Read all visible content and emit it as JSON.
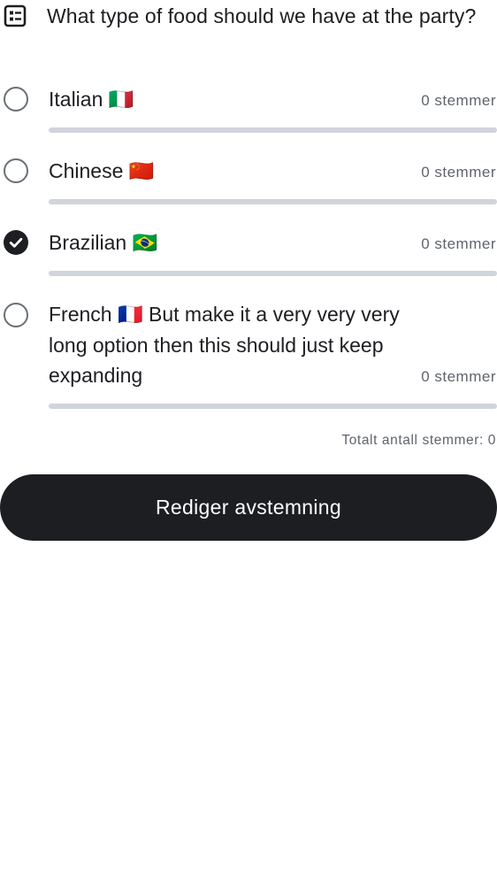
{
  "poll": {
    "icon": "poll-list-icon",
    "question": "What type of food should we have at the party?",
    "options": [
      {
        "label": "Italian 🇮🇹",
        "votes_text": "0 stemmer",
        "selected": false,
        "share": 0
      },
      {
        "label": "Chinese 🇨🇳",
        "votes_text": "0 stemmer",
        "selected": false,
        "share": 0
      },
      {
        "label": "Brazilian 🇧🇷",
        "votes_text": "0 stemmer",
        "selected": true,
        "share": 0
      },
      {
        "label": "French 🇫🇷 But make it a very very very long option then this should just keep expanding",
        "votes_text": "0 stemmer",
        "selected": false,
        "share": 0
      }
    ],
    "total_votes_text": "Totalt antall stemmer: 0",
    "edit_button_label": "Rediger avstemning"
  },
  "colors": {
    "primary": "#1d1e22",
    "muted_text": "#5f646b",
    "bar_track": "#d0d4db",
    "radio_border": "#6a6f76"
  }
}
